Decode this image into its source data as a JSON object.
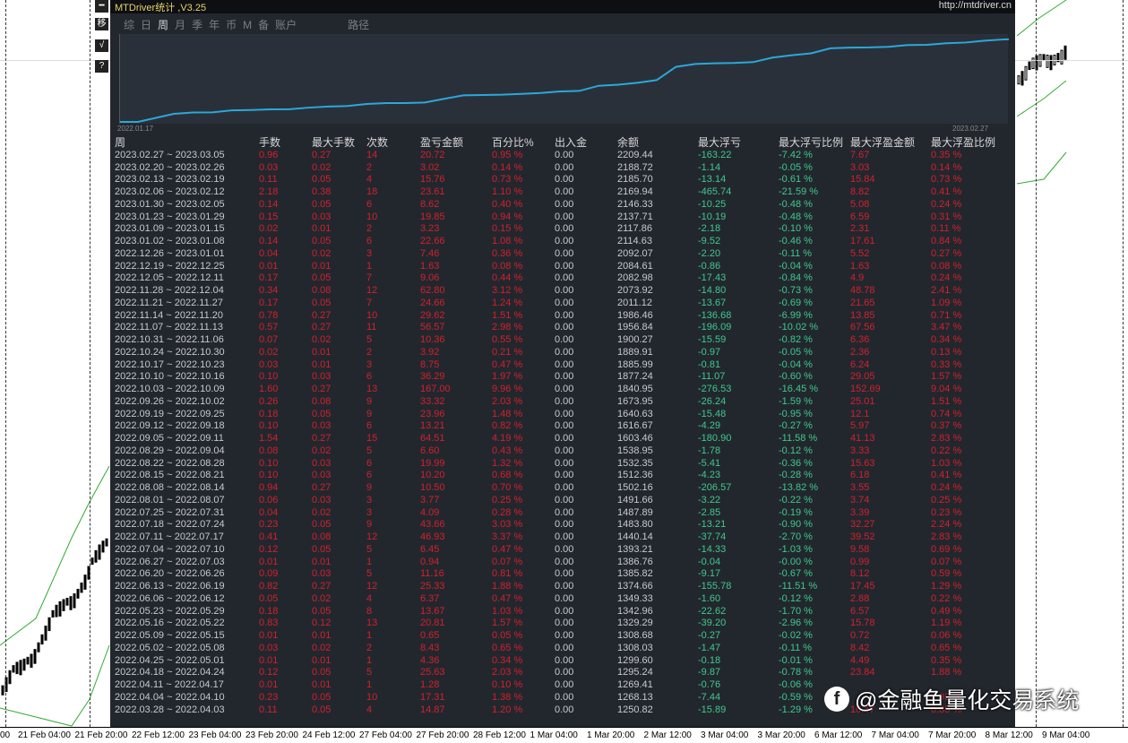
{
  "window": {
    "title": "MTDriver统计 ,V3.25",
    "url": "http://mtdriver.cn"
  },
  "side_buttons": [
    "━",
    "移",
    "√",
    "?"
  ],
  "tabs": [
    {
      "label": "综"
    },
    {
      "label": "日"
    },
    {
      "label": "周",
      "active": true
    },
    {
      "label": "月"
    },
    {
      "label": "季"
    },
    {
      "label": "年"
    },
    {
      "label": "币"
    },
    {
      "label": "M"
    },
    {
      "label": "备"
    },
    {
      "label": "账户"
    },
    {
      "label": "路径"
    }
  ],
  "equity_chart": {
    "start_label": "2022.01.17",
    "end_label": "2023.02.27",
    "line_color": "#2aa8dc"
  },
  "colors": {
    "profit": "#d4202a",
    "drawdown": "#3fc98a",
    "panel": "#22272e"
  },
  "table": {
    "headers": [
      "周",
      "手数",
      "最大手数",
      "次数",
      "盈亏金额",
      "百分比%",
      "出入金",
      "余额",
      "最大浮亏",
      "最大浮亏比例",
      "最大浮盈金额",
      "最大浮盈比例"
    ],
    "rows": [
      [
        "2023.02.27 ~ 2023.03.05",
        "0.96",
        "0.27",
        "14",
        "20.72",
        "0.95 %",
        "0.00",
        "2209.44",
        "-163.22",
        "-7.42 %",
        "7.67",
        "0.35 %"
      ],
      [
        "2023.02.20 ~ 2023.02.26",
        "0.03",
        "0.02",
        "2",
        "3.02",
        "0.14 %",
        "0.00",
        "2188.72",
        "-1.14",
        "-0.05 %",
        "3.03",
        "0.14 %"
      ],
      [
        "2023.02.13 ~ 2023.02.19",
        "0.11",
        "0.05",
        "4",
        "15.76",
        "0.73 %",
        "0.00",
        "2185.70",
        "-13.14",
        "-0.61 %",
        "15.84",
        "0.73 %"
      ],
      [
        "2023.02.06 ~ 2023.02.12",
        "2.18",
        "0.38",
        "18",
        "23.61",
        "1.10 %",
        "0.00",
        "2169.94",
        "-465.74",
        "-21.59 %",
        "8.82",
        "0.41 %"
      ],
      [
        "2023.01.30 ~ 2023.02.05",
        "0.14",
        "0.05",
        "6",
        "8.62",
        "0.40 %",
        "0.00",
        "2146.33",
        "-10.25",
        "-0.48 %",
        "5.08",
        "0.24 %"
      ],
      [
        "2023.01.23 ~ 2023.01.29",
        "0.15",
        "0.03",
        "10",
        "19.85",
        "0.94 %",
        "0.00",
        "2137.71",
        "-10.19",
        "-0.48 %",
        "6.59",
        "0.31 %"
      ],
      [
        "2023.01.09 ~ 2023.01.15",
        "0.02",
        "0.01",
        "2",
        "3.23",
        "0.15 %",
        "0.00",
        "2117.86",
        "-2.18",
        "-0.10 %",
        "2.31",
        "0.11 %"
      ],
      [
        "2023.01.02 ~ 2023.01.08",
        "0.14",
        "0.05",
        "6",
        "22.66",
        "1.08 %",
        "0.00",
        "2114.63",
        "-9.52",
        "-0.46 %",
        "17.61",
        "0.84 %"
      ],
      [
        "2022.12.26 ~ 2023.01.01",
        "0.04",
        "0.02",
        "3",
        "7.46",
        "0.36 %",
        "0.00",
        "2092.07",
        "-2.20",
        "-0.11 %",
        "5.52",
        "0.27 %"
      ],
      [
        "2022.12.19 ~ 2022.12.25",
        "0.01",
        "0.01",
        "1",
        "1.63",
        "0.08 %",
        "0.00",
        "2084.61",
        "-0.86",
        "-0.04 %",
        "1.63",
        "0.08 %"
      ],
      [
        "2022.12.05 ~ 2022.12.11",
        "0.17",
        "0.05",
        "7",
        "9.06",
        "0.44 %",
        "0.00",
        "2082.98",
        "-17.43",
        "-0.84 %",
        "4.9",
        "0.24 %"
      ],
      [
        "2022.11.28 ~ 2022.12.04",
        "0.34",
        "0.08",
        "12",
        "62.80",
        "3.12 %",
        "0.00",
        "2073.92",
        "-14.80",
        "-0.73 %",
        "48.78",
        "2.41 %"
      ],
      [
        "2022.11.21 ~ 2022.11.27",
        "0.17",
        "0.05",
        "7",
        "24.66",
        "1.24 %",
        "0.00",
        "2011.12",
        "-13.67",
        "-0.69 %",
        "21.65",
        "1.09 %"
      ],
      [
        "2022.11.14 ~ 2022.11.20",
        "0.78",
        "0.27",
        "10",
        "29.62",
        "1.51 %",
        "0.00",
        "1986.46",
        "-136.68",
        "-6.99 %",
        "13.85",
        "0.71 %"
      ],
      [
        "2022.11.07 ~ 2022.11.13",
        "0.57",
        "0.27",
        "11",
        "56.57",
        "2.98 %",
        "0.00",
        "1956.84",
        "-196.09",
        "-10.02 %",
        "67.56",
        "3.47 %"
      ],
      [
        "2022.10.31 ~ 2022.11.06",
        "0.07",
        "0.02",
        "5",
        "10.36",
        "0.55 %",
        "0.00",
        "1900.27",
        "-15.59",
        "-0.82 %",
        "6.36",
        "0.34 %"
      ],
      [
        "2022.10.24 ~ 2022.10.30",
        "0.02",
        "0.01",
        "2",
        "3.92",
        "0.21 %",
        "0.00",
        "1889.91",
        "-0.97",
        "-0.05 %",
        "2.36",
        "0.13 %"
      ],
      [
        "2022.10.17 ~ 2022.10.23",
        "0.03",
        "0.01",
        "3",
        "8.75",
        "0.47 %",
        "0.00",
        "1885.99",
        "-0.81",
        "-0.04 %",
        "6.24",
        "0.33 %"
      ],
      [
        "2022.10.10 ~ 2022.10.16",
        "0.10",
        "0.03",
        "6",
        "36.29",
        "1.97 %",
        "0.00",
        "1877.24",
        "-11.07",
        "-0.60 %",
        "29.05",
        "1.57 %"
      ],
      [
        "2022.10.03 ~ 2022.10.09",
        "1.60",
        "0.27",
        "13",
        "167.00",
        "9.96 %",
        "0.00",
        "1840.95",
        "-276.53",
        "-16.45 %",
        "152.69",
        "9.04 %"
      ],
      [
        "2022.09.26 ~ 2022.10.02",
        "0.26",
        "0.08",
        "9",
        "33.32",
        "2.03 %",
        "0.00",
        "1673.95",
        "-26.24",
        "-1.59 %",
        "25.01",
        "1.51 %"
      ],
      [
        "2022.09.19 ~ 2022.09.25",
        "0.18",
        "0.05",
        "9",
        "23.96",
        "1.48 %",
        "0.00",
        "1640.63",
        "-15.48",
        "-0.95 %",
        "12.1",
        "0.74 %"
      ],
      [
        "2022.09.12 ~ 2022.09.18",
        "0.10",
        "0.03",
        "6",
        "13.21",
        "0.82 %",
        "0.00",
        "1616.67",
        "-4.29",
        "-0.27 %",
        "5.97",
        "0.37 %"
      ],
      [
        "2022.09.05 ~ 2022.09.11",
        "1.54",
        "0.27",
        "15",
        "64.51",
        "4.19 %",
        "0.00",
        "1603.46",
        "-180.90",
        "-11.58 %",
        "41.13",
        "2.83 %"
      ],
      [
        "2022.08.29 ~ 2022.09.04",
        "0.08",
        "0.02",
        "5",
        "6.60",
        "0.43 %",
        "0.00",
        "1538.95",
        "-1.78",
        "-0.12 %",
        "3.33",
        "0.22 %"
      ],
      [
        "2022.08.22 ~ 2022.08.28",
        "0.10",
        "0.03",
        "6",
        "19.99",
        "1.32 %",
        "0.00",
        "1532.35",
        "-5.41",
        "-0.36 %",
        "15.63",
        "1.03 %"
      ],
      [
        "2022.08.15 ~ 2022.08.21",
        "0.10",
        "0.03",
        "6",
        "10.20",
        "0.68 %",
        "0.00",
        "1512.36",
        "-4.23",
        "-0.28 %",
        "6.18",
        "0.41 %"
      ],
      [
        "2022.08.08 ~ 2022.08.14",
        "0.94",
        "0.27",
        "9",
        "10.50",
        "0.70 %",
        "0.00",
        "1502.16",
        "-206.57",
        "-13.82 %",
        "3.55",
        "0.24 %"
      ],
      [
        "2022.08.01 ~ 2022.08.07",
        "0.06",
        "0.03",
        "3",
        "3.77",
        "0.25 %",
        "0.00",
        "1491.66",
        "-3.22",
        "-0.22 %",
        "3.74",
        "0.25 %"
      ],
      [
        "2022.07.25 ~ 2022.07.31",
        "0.04",
        "0.02",
        "3",
        "4.09",
        "0.28 %",
        "0.00",
        "1487.89",
        "-2.85",
        "-0.19 %",
        "3.39",
        "0.23 %"
      ],
      [
        "2022.07.18 ~ 2022.07.24",
        "0.23",
        "0.05",
        "9",
        "43.66",
        "3.03 %",
        "0.00",
        "1483.80",
        "-13.21",
        "-0.90 %",
        "32.27",
        "2.24 %"
      ],
      [
        "2022.07.11 ~ 2022.07.17",
        "0.41",
        "0.08",
        "12",
        "46.93",
        "3.37 %",
        "0.00",
        "1440.14",
        "-37.74",
        "-2.70 %",
        "39.52",
        "2.83 %"
      ],
      [
        "2022.07.04 ~ 2022.07.10",
        "0.12",
        "0.05",
        "5",
        "6.45",
        "0.47 %",
        "0.00",
        "1393.21",
        "-14.33",
        "-1.03 %",
        "9.58",
        "0.69 %"
      ],
      [
        "2022.06.27 ~ 2022.07.03",
        "0.01",
        "0.01",
        "1",
        "0.94",
        "0.07 %",
        "0.00",
        "1386.76",
        "-0.04",
        "-0.00 %",
        "0.99",
        "0.07 %"
      ],
      [
        "2022.06.20 ~ 2022.06.26",
        "0.09",
        "0.03",
        "5",
        "11.16",
        "0.81 %",
        "0.00",
        "1385.82",
        "-9.17",
        "-0.67 %",
        "8.12",
        "0.59 %"
      ],
      [
        "2022.06.13 ~ 2022.06.19",
        "0.82",
        "0.27",
        "12",
        "25.33",
        "1.88 %",
        "0.00",
        "1374.66",
        "-155.78",
        "-11.51 %",
        "17.45",
        "1.29 %"
      ],
      [
        "2022.06.06 ~ 2022.06.12",
        "0.05",
        "0.02",
        "4",
        "6.37",
        "0.47 %",
        "0.00",
        "1349.33",
        "-1.60",
        "-0.12 %",
        "2.88",
        "0.22 %"
      ],
      [
        "2022.05.23 ~ 2022.05.29",
        "0.18",
        "0.05",
        "8",
        "13.67",
        "1.03 %",
        "0.00",
        "1342.96",
        "-22.62",
        "-1.70 %",
        "6.57",
        "0.49 %"
      ],
      [
        "2022.05.16 ~ 2022.05.22",
        "0.83",
        "0.12",
        "13",
        "20.81",
        "1.57 %",
        "0.00",
        "1329.29",
        "-39.20",
        "-2.96 %",
        "15.78",
        "1.19 %"
      ],
      [
        "2022.05.09 ~ 2022.05.15",
        "0.01",
        "0.01",
        "1",
        "0.65",
        "0.05 %",
        "0.00",
        "1308.68",
        "-0.27",
        "-0.02 %",
        "0.72",
        "0.06 %"
      ],
      [
        "2022.05.02 ~ 2022.05.08",
        "0.03",
        "0.02",
        "2",
        "8.43",
        "0.65 %",
        "0.00",
        "1308.03",
        "-1.47",
        "-0.11 %",
        "8.42",
        "0.65 %"
      ],
      [
        "2022.04.25 ~ 2022.05.01",
        "0.01",
        "0.01",
        "1",
        "4.36",
        "0.34 %",
        "0.00",
        "1299.60",
        "-0.18",
        "-0.01 %",
        "4.49",
        "0.35 %"
      ],
      [
        "2022.04.18 ~ 2022.04.24",
        "0.12",
        "0.05",
        "5",
        "25.63",
        "2.03 %",
        "0.00",
        "1295.24",
        "-9.87",
        "-0.78 %",
        "23.84",
        "1.88 %"
      ],
      [
        "2022.04.11 ~ 2022.04.17",
        "0.01",
        "0.01",
        "1",
        "1.28",
        "0.10 %",
        "0.00",
        "1269.41",
        "-0.76",
        "-0.06 %",
        "",
        ""
      ],
      [
        "2022.04.04 ~ 2022.04.10",
        "0.23",
        "0.05",
        "10",
        "17.31",
        "1.38 %",
        "0.00",
        "1268.13",
        "-7.44",
        "-0.59 %",
        "",
        "0.92 %"
      ],
      [
        "2022.03.28 ~ 2022.04.03",
        "0.11",
        "0.05",
        "4",
        "14.87",
        "1.20 %",
        "0.00",
        "1250.82",
        "-15.89",
        "-1.29 %",
        "10.47",
        "0.85 %"
      ]
    ]
  },
  "time_axis": [
    "00",
    "21 Feb 04:00",
    "21 Feb 20:00",
    "22 Feb 12:00",
    "23 Feb 04:00",
    "23 Feb 20:00",
    "24 Feb 12:00",
    "27 Feb 04:00",
    "27 Feb 20:00",
    "28 Feb 12:00",
    "1 Mar 04:00",
    "1 Mar 20:00",
    "2 Mar 12:00",
    "3 Mar 04:00",
    "3 Mar 20:00",
    "6 Mar 12:00",
    "7 Mar 04:00",
    "7 Mar 20:00",
    "8 Mar 12:00",
    "9 Mar 04:00"
  ],
  "watermark": "@金融鱼量化交易系统"
}
